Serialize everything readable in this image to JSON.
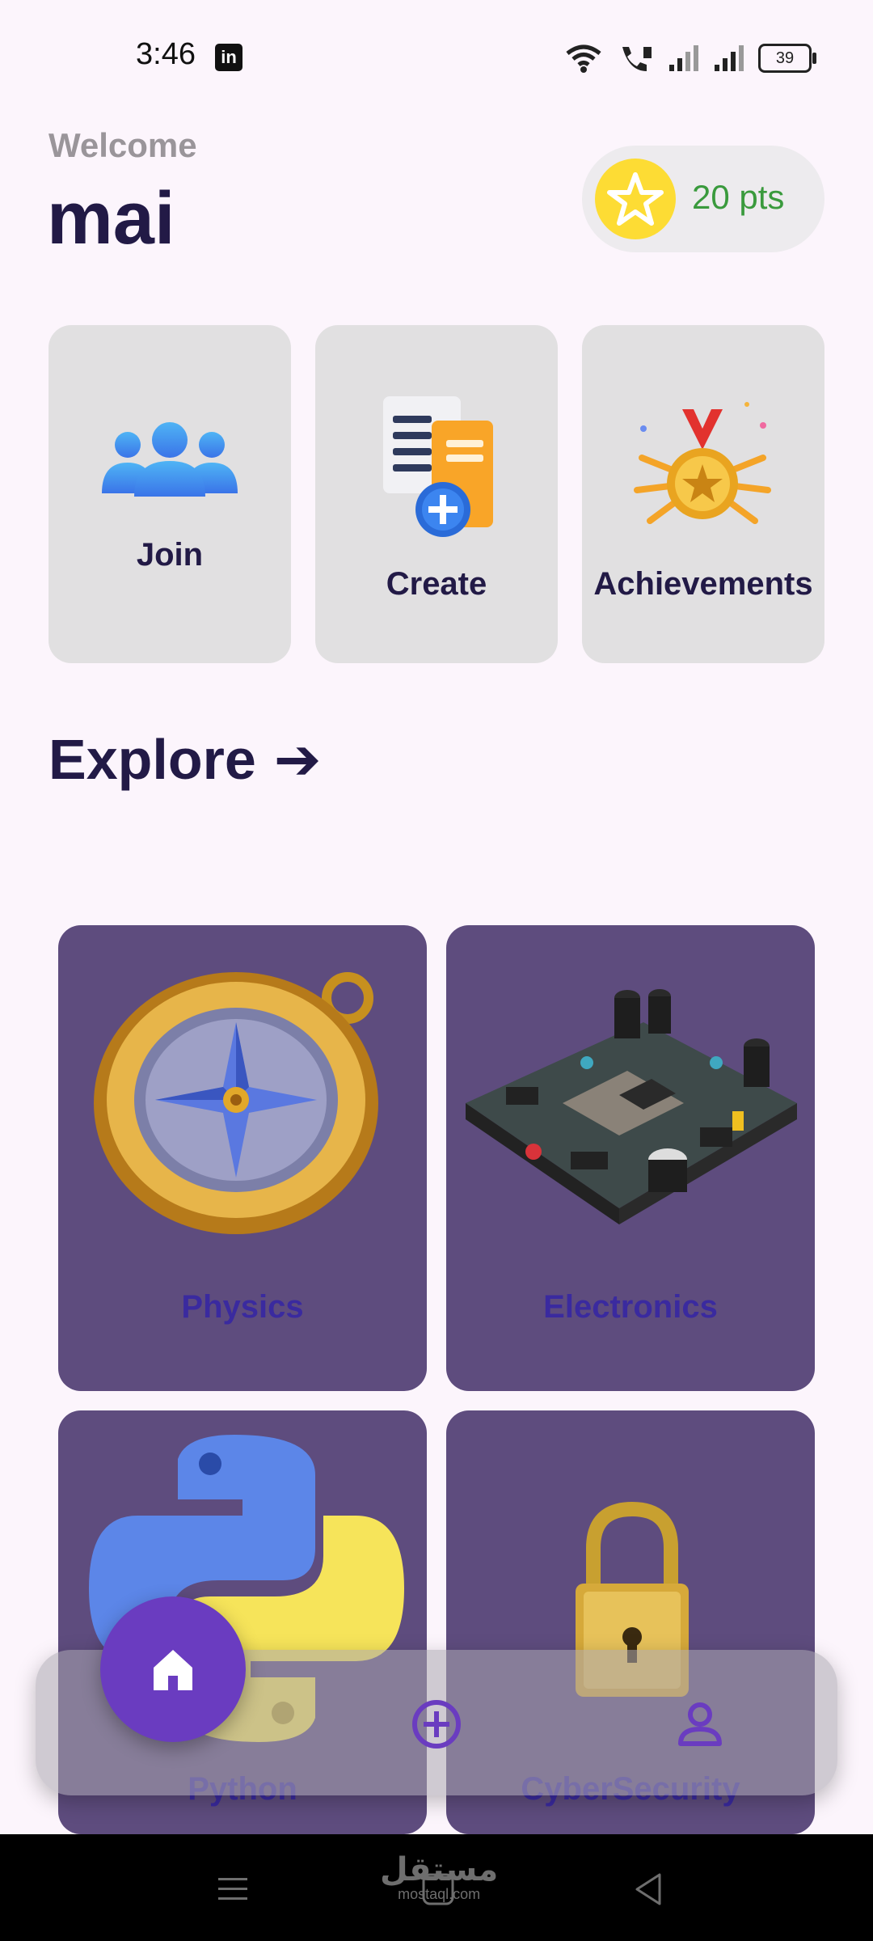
{
  "status_bar": {
    "time": "3:46",
    "battery": "39",
    "app_icon": "linkedin-icon"
  },
  "header": {
    "welcome": "Welcome",
    "username": "mai",
    "points": "20 pts"
  },
  "actions": [
    {
      "label": "Join",
      "icon": "group-icon"
    },
    {
      "label": "Create",
      "icon": "create-document-icon"
    },
    {
      "label": "Achievements",
      "icon": "medal-icon"
    }
  ],
  "explore": {
    "title": "Explore",
    "arrow": "➔"
  },
  "topics": [
    {
      "label": "Physics",
      "icon": "compass-icon"
    },
    {
      "label": "Electronics",
      "icon": "circuit-board-icon"
    },
    {
      "label": "Python",
      "icon": "python-logo-icon"
    },
    {
      "label": "CyberSecurity",
      "icon": "padlock-icon"
    }
  ],
  "bottom_nav": {
    "home": "home-icon",
    "add": "add-circle-icon",
    "profile": "profile-icon"
  },
  "watermark": {
    "arabic": "مستقل",
    "latin": "mostaql.com"
  },
  "colors": {
    "background": "#FCF5FC",
    "card": "#E1E0E1",
    "topic_card": "#5E4C7E",
    "topic_label": "#3A2A9F",
    "points_green": "#3A9A3D",
    "accent_purple": "#6A3CC0",
    "star_yellow": "#FDDC34"
  }
}
